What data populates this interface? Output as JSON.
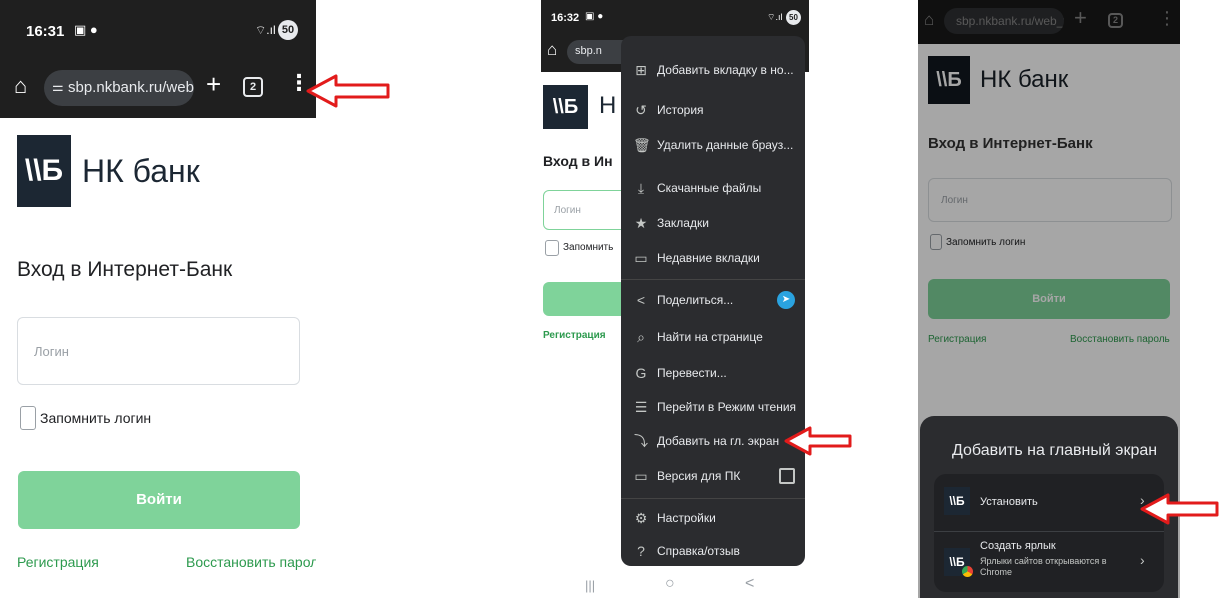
{
  "panel1": {
    "time": "16:31",
    "battery": "50",
    "url": "sbp.nkbank.ru/web_t",
    "tabs": "2",
    "bank_name": "НК банк",
    "logo_text": "\\\\Б",
    "heading": "Вход в Интернет-Банк",
    "login_placeholder": "Логин",
    "remember_label": "Запомнить логин",
    "login_button": "Войти",
    "register_link": "Регистрация",
    "restore_link": "Восстановить пароль"
  },
  "panel2": {
    "time": "16:32",
    "battery": "50",
    "url": "sbp.n",
    "bank_name_partial": "Н",
    "heading_partial": "Вход в Ин",
    "login_placeholder": "Логин",
    "remember_partial": "Запомнить",
    "register_link": "Регистрация",
    "menu_items": [
      {
        "icon": "add-tab-group-icon",
        "glyph": "⊞",
        "label": "Добавить вкладку в но..."
      },
      {
        "icon": "history-icon",
        "glyph": "↺",
        "label": "История"
      },
      {
        "icon": "trash-icon",
        "glyph": "🗑",
        "label": "Удалить данные брауз..."
      },
      {
        "icon": "download-icon",
        "glyph": "⤓",
        "label": "Скачанные файлы"
      },
      {
        "icon": "star-icon",
        "glyph": "★",
        "label": "Закладки"
      },
      {
        "icon": "recent-tabs-icon",
        "glyph": "▭",
        "label": "Недавние вкладки"
      },
      {
        "icon": "share-icon",
        "glyph": "<",
        "label": "Поделиться..."
      },
      {
        "icon": "find-in-page-icon",
        "glyph": "⌕",
        "label": "Найти на странице"
      },
      {
        "icon": "translate-icon",
        "glyph": "G",
        "label": "Перевести..."
      },
      {
        "icon": "reader-mode-icon",
        "glyph": "☰",
        "label": "Перейти в Режим чтения"
      },
      {
        "icon": "add-to-home-icon",
        "glyph": "⤵",
        "label": "Добавить на гл. экран"
      },
      {
        "icon": "desktop-icon",
        "glyph": "▭",
        "label": "Версия для ПК"
      },
      {
        "icon": "settings-icon",
        "glyph": "⚙",
        "label": "Настройки"
      },
      {
        "icon": "help-icon",
        "glyph": "?",
        "label": "Справка/отзыв"
      }
    ],
    "nav": {
      "recents": "|||",
      "home": "○",
      "back": "<"
    }
  },
  "panel3": {
    "url": "sbp.nkbank.ru/web_t",
    "tabs": "2",
    "bank_name": "НК банк",
    "heading": "Вход в Интернет-Банк",
    "login_placeholder": "Логин",
    "remember_label": "Запомнить логин",
    "login_button": "Войти",
    "register_link": "Регистрация",
    "restore_link": "Восстановить пароль",
    "sheet_title": "Добавить на главный экран",
    "install_label": "Установить",
    "shortcut_title": "Создать ярлык",
    "shortcut_subtitle": "Ярлыки сайтов открываются в Chrome"
  },
  "colors": {
    "accent_green": "#7fd39a",
    "link_green": "#2d9a4e",
    "arrow_red": "#e21b1b",
    "logo_navy": "#1c2733",
    "menu_bg": "#2b2c2f"
  }
}
